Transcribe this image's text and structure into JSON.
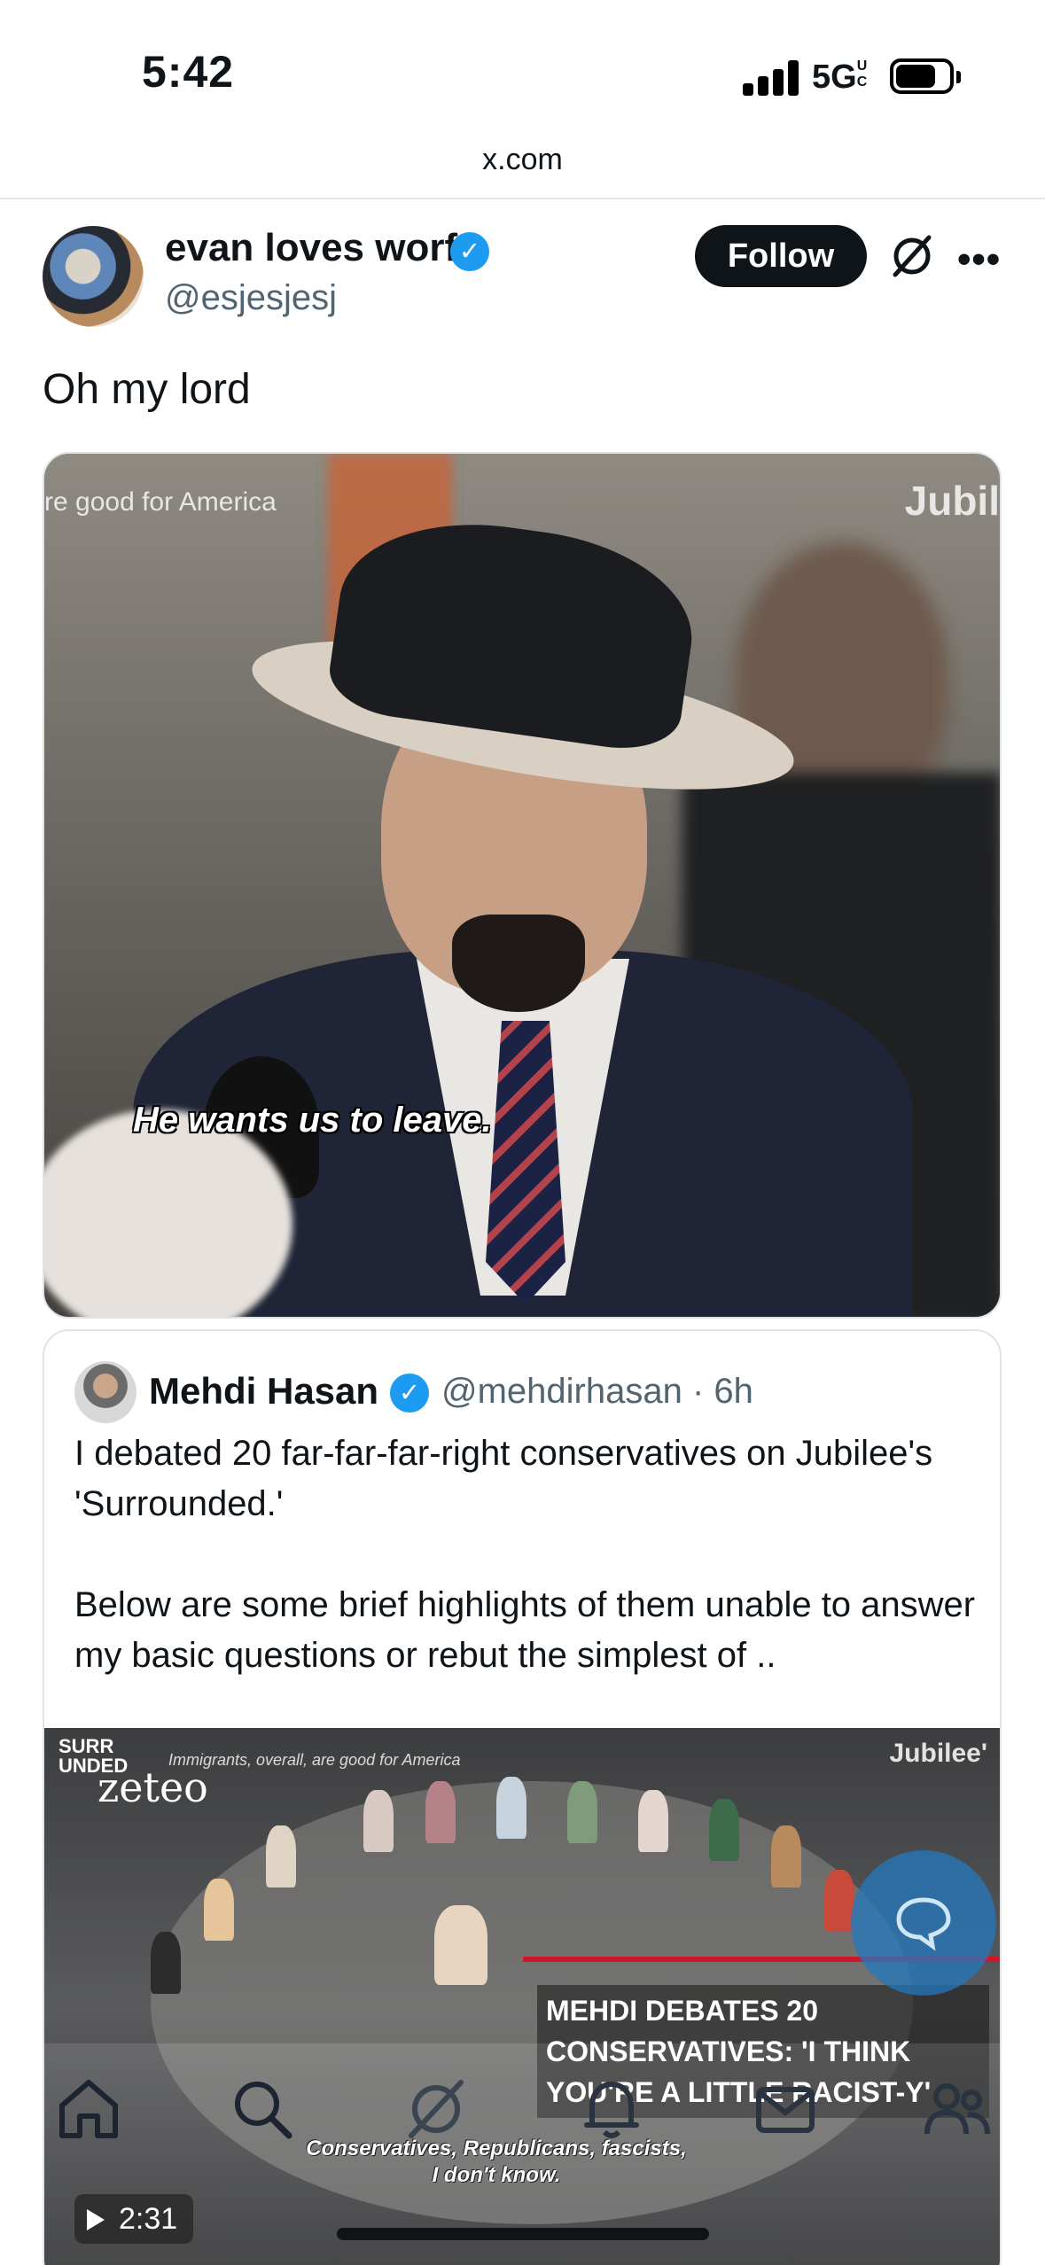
{
  "status_bar": {
    "time": "5:42",
    "network": "5G",
    "network_sup": "UC"
  },
  "browser": {
    "url": "x.com"
  },
  "tweet": {
    "author_name": "evan loves worf",
    "author_handle": "@esjesjesj",
    "follow_label": "Follow",
    "text": "Oh my lord",
    "video": {
      "overlay_text": "re good for America",
      "logo": "Jubil",
      "caption": "He wants us to leave."
    }
  },
  "quoted_tweet": {
    "author_name": "Mehdi Hasan",
    "author_handle": "@mehdirhasan · 6h",
    "text": "I debated 20 far-far-far-right conservatives on Jubilee's 'Surrounded.'\n\nBelow are some brief highlights of them unable to answer my basic questions or rebut the simplest of ..",
    "video": {
      "corner_text": "SURR\nUNDED",
      "zeteo": "zeteo",
      "top_text": "Immigrants, overall, are good for America",
      "logo": "Jubilee'",
      "title": "MEHDI DEBATES 20 CONSERVATIVES: 'I THINK YOU'RE A LITTLE RACIST-Y'",
      "subtitle": "Conservatives, Republicans, fascists, I don't know.",
      "duration": "2:31"
    }
  },
  "icons": {
    "verified": "verified-badge-icon",
    "grok": "grok-icon",
    "more": "more-icon",
    "compose": "compose-reply-icon",
    "nav": [
      "home-icon",
      "search-icon",
      "grok-icon",
      "notifications-icon",
      "messages-icon",
      "communities-icon"
    ]
  },
  "colors": {
    "accent": "#1d9bf0",
    "text": "#0f1419",
    "secondary": "#536471",
    "follow_bg": "#0f1419"
  }
}
